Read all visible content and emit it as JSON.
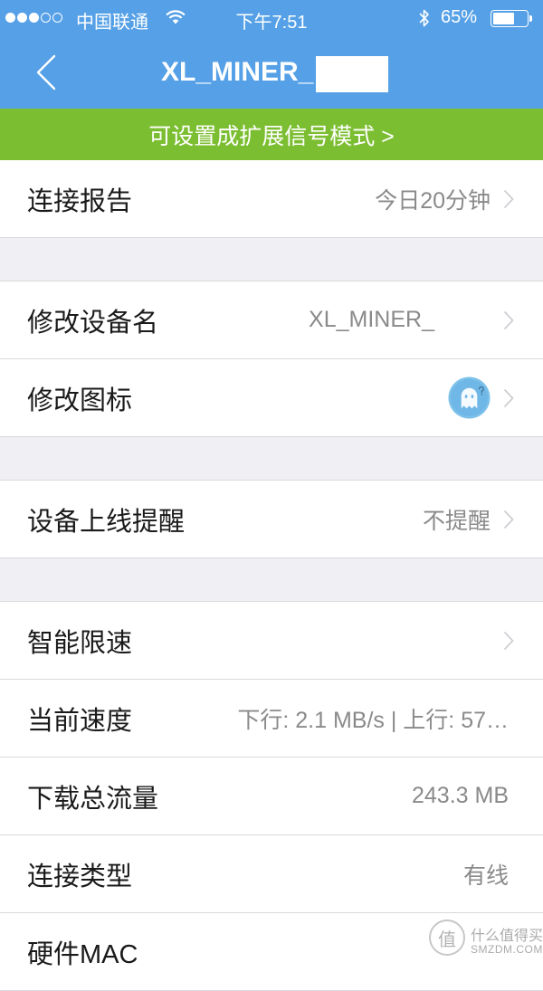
{
  "status_bar": {
    "signal_strength": 3,
    "signal_max": 5,
    "carrier": "中国联通",
    "time": "下午7:51",
    "battery_text": "65%",
    "battery_level": 0.65,
    "icons": [
      "wifi-icon",
      "bluetooth-icon",
      "battery-icon"
    ]
  },
  "nav": {
    "title": "XL_MINER_",
    "back_icon": "chevron-left-icon"
  },
  "banner": {
    "text": "可设置成扩展信号模式 >"
  },
  "sections": [
    {
      "rows": [
        {
          "label": "连接报告",
          "value": "今日20分钟"
        }
      ]
    },
    {
      "rows": [
        {
          "label": "修改设备名",
          "value": "XL_MINER_"
        },
        {
          "label": "修改图标",
          "icon": "ghost-avatar-icon"
        }
      ]
    },
    {
      "rows": [
        {
          "label": "设备上线提醒",
          "value": "不提醒"
        }
      ]
    },
    {
      "rows": [
        {
          "label": "智能限速"
        },
        {
          "label": "当前速度",
          "value": "下行: 2.1 MB/s | 上行: 57…"
        },
        {
          "label": "下载总流量",
          "value": "243.3 MB"
        },
        {
          "label": "连接类型",
          "value": "有线"
        },
        {
          "label": "硬件MAC"
        }
      ]
    }
  ],
  "watermark": {
    "logo_char": "值",
    "name": "什么值得买",
    "site": "SMZDM.COM"
  },
  "colors": {
    "nav_bar": "#55a0e6",
    "banner": "#7cbe31",
    "background": "#efeff4",
    "label_text": "#1a1a1a",
    "value_text": "#8a8a8a",
    "chevron": "#c8c8cd"
  }
}
